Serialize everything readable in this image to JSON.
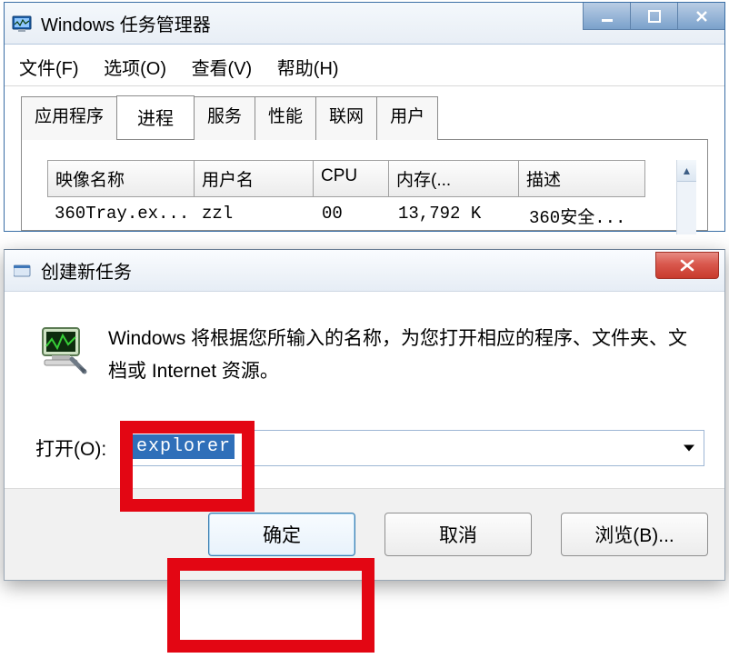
{
  "task_manager": {
    "title": "Windows 任务管理器",
    "menu": {
      "file": "文件(F)",
      "options": "选项(O)",
      "view": "查看(V)",
      "help": "帮助(H)"
    },
    "tabs": {
      "apps": "应用程序",
      "processes": "进程",
      "services": "服务",
      "perf": "性能",
      "network": "联网",
      "users": "用户"
    },
    "columns": {
      "image": "映像名称",
      "user": "用户名",
      "cpu": "CPU",
      "mem": "内存(...",
      "desc": "描述"
    },
    "rows": [
      {
        "image": "360Tray.ex...",
        "user": "zzl",
        "cpu": "00",
        "mem": "13,792 K",
        "desc": "360安全..."
      }
    ]
  },
  "dialog": {
    "title": "创建新任务",
    "description": "Windows 将根据您所输入的名称，为您打开相应的程序、文件夹、文档或 Internet 资源。",
    "open_label": "打开(O):",
    "open_value": "explorer",
    "buttons": {
      "ok": "确定",
      "cancel": "取消",
      "browse": "浏览(B)..."
    }
  }
}
